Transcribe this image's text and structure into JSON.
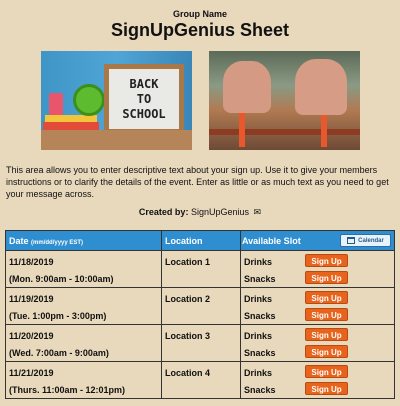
{
  "header": {
    "group_name": "Group Name",
    "title": "SignUpGenius Sheet"
  },
  "images": {
    "left_board_lines": [
      "BACK",
      "TO",
      "SCHOOL"
    ]
  },
  "description": "This area allows you to enter descriptive text about your sign up. Use it to give your members instructions or to clarify the details of the event. Enter as little or as much text as you need to get your message across.",
  "created_by": {
    "label": "Created by:",
    "name": "SignUpGenius",
    "icon": "envelope-icon"
  },
  "table": {
    "headers": {
      "date": "Date",
      "date_format": "(mm/dd/yyyy EST)",
      "location": "Location",
      "slot": "Available Slot",
      "calendar": "Calendar"
    },
    "rows": [
      {
        "date": "11/18/2019",
        "time": "(Mon. 9:00am - 10:00am)",
        "location": "Location 1",
        "items": [
          "Drinks",
          "Snacks"
        ],
        "button": "Sign Up"
      },
      {
        "date": "11/19/2019",
        "time": "(Tue. 1:00pm - 3:00pm)",
        "location": "Location 2",
        "items": [
          "Drinks",
          "Snacks"
        ],
        "button": "Sign Up"
      },
      {
        "date": "11/20/2019",
        "time": "(Wed. 7:00am - 9:00am)",
        "location": "Location 3",
        "items": [
          "Drinks",
          "Snacks"
        ],
        "button": "Sign Up"
      },
      {
        "date": "11/21/2019",
        "time": "(Thurs. 11:00am - 12:01pm)",
        "location": "Location 4",
        "items": [
          "Drinks",
          "Snacks"
        ],
        "button": "Sign Up"
      }
    ]
  },
  "colors": {
    "background": "#e8d8bc",
    "header_blue": "#2f8ed0",
    "button_orange": "#e8641d"
  }
}
